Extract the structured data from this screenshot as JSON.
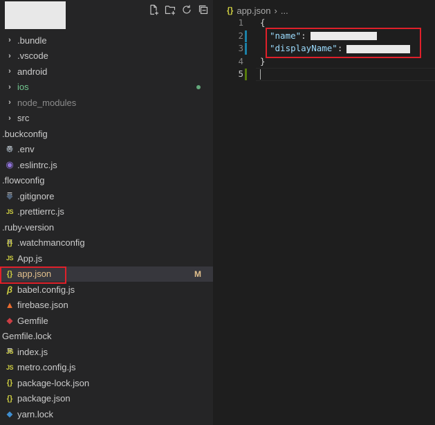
{
  "explorer": {
    "header_actions": [
      {
        "name": "new-file-icon"
      },
      {
        "name": "new-folder-icon"
      },
      {
        "name": "refresh-icon"
      },
      {
        "name": "collapse-all-icon"
      }
    ],
    "items": [
      {
        "label": ".bundle",
        "type": "folder",
        "icon": "chevron-right-icon",
        "glyph": "›"
      },
      {
        "label": ".vscode",
        "type": "folder",
        "icon": "chevron-right-icon",
        "glyph": "›"
      },
      {
        "label": "android",
        "type": "folder",
        "icon": "chevron-right-icon",
        "glyph": "›"
      },
      {
        "label": "ios",
        "type": "folder",
        "icon": "chevron-right-icon",
        "glyph": "›",
        "git": "untracked"
      },
      {
        "label": "node_modules",
        "type": "folder",
        "icon": "chevron-right-icon",
        "glyph": "›",
        "dim": true
      },
      {
        "label": "src",
        "type": "folder",
        "icon": "chevron-right-icon",
        "glyph": "›"
      },
      {
        "label": ".buckconfig",
        "type": "file",
        "icon": "lines-file-icon",
        "glyph": "≡"
      },
      {
        "label": ".env",
        "type": "file",
        "icon": "gear-icon",
        "glyph": "⚙"
      },
      {
        "label": ".eslintrc.js",
        "type": "file",
        "icon": "eslint-icon",
        "glyph": "◉"
      },
      {
        "label": ".flowconfig",
        "type": "file",
        "icon": "lines-file-icon",
        "glyph": "≡"
      },
      {
        "label": ".gitignore",
        "type": "file",
        "icon": "git-icon",
        "glyph": "◆"
      },
      {
        "label": ".prettierrc.js",
        "type": "file",
        "icon": "js-file-icon",
        "glyph": "JS"
      },
      {
        "label": ".ruby-version",
        "type": "file",
        "icon": "lines-file-icon",
        "glyph": "≡"
      },
      {
        "label": ".watchmanconfig",
        "type": "file",
        "icon": "json-file-icon",
        "glyph": "{}"
      },
      {
        "label": "App.js",
        "type": "file",
        "icon": "js-file-icon",
        "glyph": "JS"
      },
      {
        "label": "app.json",
        "type": "file",
        "icon": "json-file-icon",
        "glyph": "{}",
        "selected": true,
        "badge": "M"
      },
      {
        "label": "babel.config.js",
        "type": "file",
        "icon": "babel-icon",
        "glyph": "β"
      },
      {
        "label": "firebase.json",
        "type": "file",
        "icon": "firebase-icon",
        "glyph": "▲"
      },
      {
        "label": "Gemfile",
        "type": "file",
        "icon": "gem-icon",
        "glyph": "◆"
      },
      {
        "label": "Gemfile.lock",
        "type": "file",
        "icon": "lines-file-icon",
        "glyph": "≡"
      },
      {
        "label": "index.js",
        "type": "file",
        "icon": "js-file-icon",
        "glyph": "JS"
      },
      {
        "label": "metro.config.js",
        "type": "file",
        "icon": "js-file-icon",
        "glyph": "JS"
      },
      {
        "label": "package-lock.json",
        "type": "file",
        "icon": "json-file-icon",
        "glyph": "{}"
      },
      {
        "label": "package.json",
        "type": "file",
        "icon": "json-file-icon",
        "glyph": "{}"
      },
      {
        "label": "yarn.lock",
        "type": "file",
        "icon": "yarn-icon",
        "glyph": "⬥"
      }
    ]
  },
  "editor": {
    "breadcrumb": {
      "icon_glyph": "{}",
      "file": "app.json",
      "sep": "›",
      "more": "..."
    },
    "lines": [
      {
        "n": "1",
        "text": "{"
      },
      {
        "n": "2",
        "key": "\"name\"",
        "colon": ":"
      },
      {
        "n": "3",
        "key": "\"displayName\"",
        "colon": ":"
      },
      {
        "n": "4",
        "text": "}"
      },
      {
        "n": "5",
        "text": ""
      }
    ]
  },
  "colors": {
    "accent_git_modified": "#e2c08d",
    "accent_git_untracked": "#73c991",
    "json_icon": "#cbcb41",
    "annotation_red": "#e0202a",
    "gutter_modified": "#1b81a8",
    "gutter_added": "#587c0c"
  }
}
